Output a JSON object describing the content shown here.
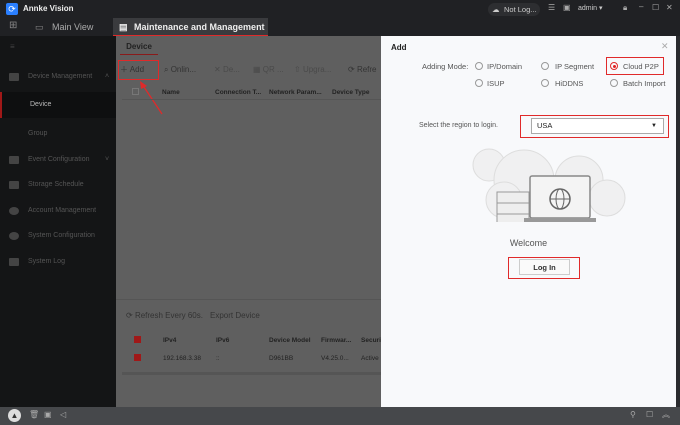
{
  "app": {
    "title": "Annke Vision"
  },
  "titlebar": {
    "cloud_status": "Not Log...",
    "user": "admin"
  },
  "tabs": [
    {
      "label": "Main View"
    },
    {
      "label": "Maintenance and Management"
    }
  ],
  "sidebar": {
    "items": [
      {
        "label": "Device Management"
      },
      {
        "label": "Device"
      },
      {
        "label": "Group"
      },
      {
        "label": "Event Configuration"
      },
      {
        "label": "Storage Schedule"
      },
      {
        "label": "Account Management"
      },
      {
        "label": "System Configuration"
      },
      {
        "label": "System Log"
      }
    ]
  },
  "main": {
    "subtab": "Device",
    "toolbar": {
      "add": "Add",
      "online": "Onlin...",
      "delete": "De...",
      "qr": "QR ...",
      "upgrade": "Upgra...",
      "refresh": "Refre"
    },
    "columns": [
      "Name",
      "Connection T...",
      "Network Param...",
      "Device Type"
    ],
    "lower": {
      "refresh": "Refresh Every 60s.",
      "export": "Export Device",
      "columns": [
        "IPv4",
        "IPv6",
        "Device Model",
        "Firmwar...",
        "Securi"
      ],
      "rows": [
        {
          "ipv4": "192.168.3.38",
          "ipv6": "::",
          "model": "D961BB",
          "firmware": "V4.25.0...",
          "security": "Active"
        }
      ]
    }
  },
  "modal": {
    "title": "Add",
    "adding_mode_label": "Adding Mode:",
    "modes": [
      {
        "label": "IP/Domain"
      },
      {
        "label": "IP Segment"
      },
      {
        "label": "Cloud P2P"
      },
      {
        "label": "ISUP"
      },
      {
        "label": "HiDDNS"
      },
      {
        "label": "Batch Import"
      }
    ],
    "selected_mode": "Cloud P2P",
    "region_label": "Select the region to login.",
    "region_value": "USA",
    "welcome": "Welcome",
    "login": "Log In"
  },
  "colors": {
    "accent": "#e02a2a",
    "brand": "#2a7fff"
  }
}
